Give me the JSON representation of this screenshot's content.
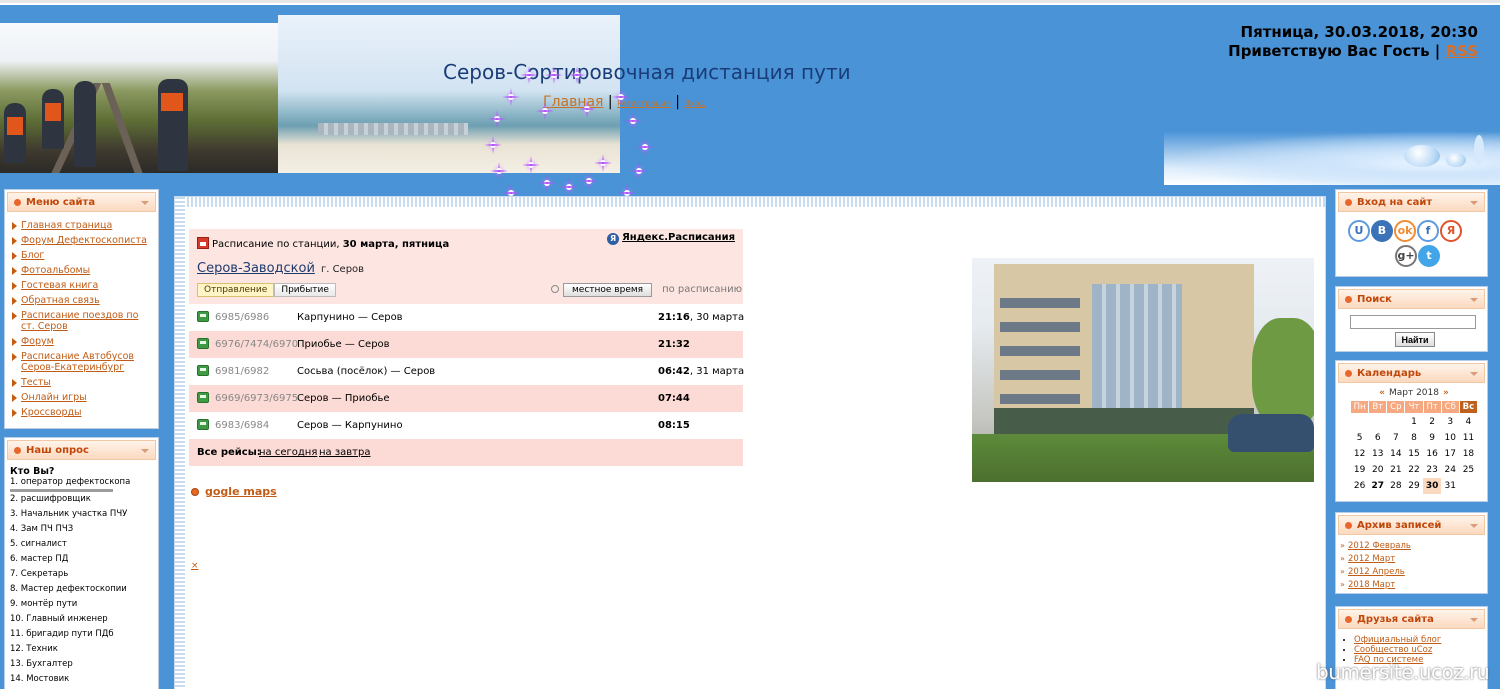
{
  "header": {
    "title": "Серов-Сортировочная дистанция пути",
    "nav_main": "Главная",
    "nav_sep1": " | ",
    "nav_register": "Регистрация",
    "nav_sep2": " | ",
    "nav_login": "Вход",
    "datetime": "Пятница, 30.03.2018, 20:30",
    "greeting": "Приветствую Вас Гость",
    "greeting_sep": " | ",
    "rss": "RSS"
  },
  "menu": {
    "title": "Меню сайта",
    "items": [
      "Главная страница",
      "Форум Дефектоскописта",
      "Блог",
      "Фотоальбомы",
      "Гостевая книга",
      "Обратная связь",
      "Расписание поездов по ст. Серов",
      "Форум",
      "Расписание Автобусов Серов-Екатеринбург",
      "Тесты",
      "Онлайн игры",
      "Кроссворды"
    ]
  },
  "poll": {
    "title": "Наш опрос",
    "question": "Кто Вы?",
    "options": [
      "1. оператор дефектоскопа",
      "2. расшифровщик",
      "3. Начальник участка ПЧУ",
      "4. Зам ПЧ ПЧЗ",
      "5. сигналист",
      "6. мастер ПД",
      "7. Секретарь",
      "8. Мастер дефектоскопии",
      "9. монтёр пути",
      "10. Главный инженер",
      "11. бригадир пути ПДб",
      "12. Техник",
      "13. Бухгалтер",
      "14. Мостовик"
    ]
  },
  "schedule": {
    "heading_prefix": "Расписание по станции, ",
    "heading_date": "30 марта, пятница",
    "yandex_link": "Яндекс.Расписания",
    "station_name": "Серов-Заводской",
    "city": "г. Серов",
    "tab_departure": "Отправление",
    "tab_arrival": "Прибытие",
    "time_button": "местное время",
    "by_schedule": "по расписанию",
    "rows": [
      {
        "num": "6985/6986",
        "route": "Карпунино — Серов",
        "time": "21:16",
        "date": ", 30 марта"
      },
      {
        "num": "6976/7474/6970",
        "route": "Приобье — Серов",
        "time": "21:32",
        "date": ""
      },
      {
        "num": "6981/6982",
        "route": "Сосьва (посёлок) — Серов",
        "time": "06:42",
        "date": ", 31 марта"
      },
      {
        "num": "6969/6973/6975",
        "route": "Серов — Приобье",
        "time": "07:44",
        "date": ""
      },
      {
        "num": "6983/6984",
        "route": "Серов — Карпунино",
        "time": "08:15",
        "date": ""
      }
    ],
    "all_trips_label": "Все рейсы:",
    "today_link": "на сегодня",
    "tomorrow_link": "на завтра"
  },
  "main": {
    "gmaps_link": "gogle maps",
    "x_mark": "×"
  },
  "login_block": {
    "title": "Вход на сайт",
    "social": [
      {
        "icon": "ucoz-icon",
        "glyph": "U"
      },
      {
        "icon": "vk-icon",
        "glyph": "В"
      },
      {
        "icon": "odnoklassniki-icon",
        "glyph": "ok"
      },
      {
        "icon": "facebook-icon",
        "glyph": "f"
      },
      {
        "icon": "yandex-icon",
        "glyph": "Я"
      },
      {
        "icon": "google-plus-icon",
        "glyph": "g+"
      },
      {
        "icon": "twitter-icon",
        "glyph": "t"
      }
    ]
  },
  "search_block": {
    "title": "Поиск",
    "input_value": "",
    "button": "Найти"
  },
  "calendar": {
    "title": "Календарь",
    "prev": "«",
    "month": "Март 2018",
    "next": "»",
    "weekdays": [
      "Пн",
      "Вт",
      "Ср",
      "Чт",
      "Пт",
      "Сб",
      "Вс"
    ],
    "weeks": [
      [
        "",
        "",
        "",
        "1",
        "2",
        "3",
        "4"
      ],
      [
        "5",
        "6",
        "7",
        "8",
        "9",
        "10",
        "11"
      ],
      [
        "12",
        "13",
        "14",
        "15",
        "16",
        "17",
        "18"
      ],
      [
        "19",
        "20",
        "21",
        "22",
        "23",
        "24",
        "25"
      ],
      [
        "26",
        "27",
        "28",
        "29",
        "30",
        "31",
        ""
      ]
    ],
    "today": "30",
    "highlighted": "27"
  },
  "archive": {
    "title": "Архив записей",
    "items": [
      "2012 Февраль",
      "2012 Март",
      "2012 Апрель",
      "2018 Март"
    ]
  },
  "friends": {
    "title": "Друзья сайта",
    "items": [
      "Официальный блог",
      "Сообщество uCoz",
      "FAQ по системе"
    ]
  },
  "watermark": "bumersite.ucoz.ru",
  "colors": {
    "background": "#4a93d6",
    "accent": "#c05c16",
    "block_header": "#fbd9bf"
  }
}
